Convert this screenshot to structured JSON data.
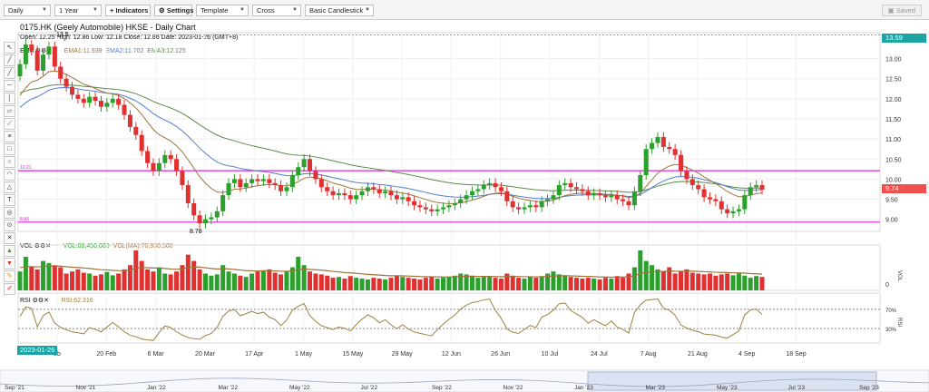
{
  "toolbar": {
    "interval": "Daily",
    "range": "1 Year",
    "indicators": "+ Indicators",
    "settings": "Settings",
    "template": "Template",
    "cursor": "Cross",
    "chart_type": "Basic Candlestick",
    "saved": "Saved"
  },
  "header": {
    "title": "0175.HK (Geely Automobile) HKSE - Daily Chart",
    "ohlc": "Open: 12.25  High: 12.86  Low: 12.18  Close: 12.86  Date: 2023-01-26 (GMT+8)",
    "ema_label": "EMA",
    "ema1": "EMA1:11.939",
    "ema2": "EMA2:11.702",
    "ema3": "EMA3:12.125",
    "vol_label": "VOL",
    "vol": "VOL:88,456,000",
    "vol_ma": "VOL(MA):70,930,500",
    "rsi_label": "RSI",
    "rsi": "RSI:62.316"
  },
  "annotations": {
    "high_label": "13.5",
    "low_label": "8.78",
    "upper_line": "10.21",
    "lower_line": "8.93",
    "last_price": "9.74",
    "top_price": "13.59",
    "cursor_date": "2023-01-26"
  },
  "colors": {
    "up": "#2ca02c",
    "down": "#e03030",
    "ema1": "#a0723a",
    "ema2": "#4f7fd0",
    "ema3": "#5a8a4a",
    "hline": "#e020e0",
    "rsi": "#a08040",
    "vol_ma": "#a0723a"
  },
  "chart_data": {
    "type": "candlestick",
    "title": "0175.HK (Geely Automobile) HKSE - Daily Chart",
    "xlim": [
      "2023-01-26",
      "2023-09-30"
    ],
    "ylim": [
      8.7,
      13.6
    ],
    "price_ticks": [
      "13.00",
      "12.50",
      "12.00",
      "11.50",
      "11.00",
      "10.50",
      "10.00",
      "9.50",
      "9.00"
    ],
    "x_ticks": [
      "eb",
      "20 Feb",
      "6 Mar",
      "20 Mar",
      "17 Apr",
      "1 May",
      "15 May",
      "29 May",
      "12 Jun",
      "26 Jun",
      "10 Jul",
      "24 Jul",
      "7 Aug",
      "21 Aug",
      "4 Sep",
      "18 Sep"
    ],
    "horizontal_lines": [
      10.21,
      8.93
    ],
    "close": [
      12.86,
      13.35,
      13.2,
      12.7,
      13.1,
      13.3,
      12.8,
      12.5,
      12.3,
      12.1,
      12.0,
      11.9,
      12.05,
      11.95,
      11.8,
      11.9,
      12.0,
      11.85,
      11.6,
      11.3,
      11.1,
      10.7,
      10.4,
      10.2,
      10.4,
      10.6,
      10.5,
      10.2,
      9.85,
      9.4,
      9.1,
      8.9,
      9.0,
      9.05,
      9.2,
      9.6,
      9.9,
      10.0,
      9.8,
      9.9,
      10.0,
      9.95,
      10.0,
      9.9,
      9.85,
      9.7,
      9.8,
      10.1,
      10.3,
      10.5,
      10.2,
      10.0,
      9.8,
      9.7,
      9.6,
      9.65,
      9.6,
      9.5,
      9.6,
      9.7,
      9.8,
      9.75,
      9.65,
      9.7,
      9.6,
      9.5,
      9.55,
      9.45,
      9.35,
      9.3,
      9.25,
      9.2,
      9.25,
      9.3,
      9.35,
      9.4,
      9.5,
      9.6,
      9.7,
      9.75,
      9.85,
      9.9,
      9.8,
      9.7,
      9.45,
      9.3,
      9.25,
      9.3,
      9.35,
      9.3,
      9.45,
      9.5,
      9.6,
      9.85,
      9.9,
      9.8,
      9.75,
      9.7,
      9.6,
      9.65,
      9.6,
      9.55,
      9.6,
      9.5,
      9.45,
      9.35,
      9.7,
      10.1,
      10.75,
      10.9,
      11.05,
      10.8,
      10.75,
      10.6,
      10.2,
      10.0,
      9.85,
      9.75,
      9.55,
      9.5,
      9.45,
      9.25,
      9.15,
      9.2,
      9.25,
      9.6,
      9.8,
      9.85,
      9.74
    ],
    "volume": [
      45,
      80,
      55,
      50,
      70,
      65,
      60,
      55,
      40,
      45,
      50,
      42,
      40,
      35,
      38,
      44,
      36,
      40,
      50,
      60,
      95,
      70,
      50,
      45,
      55,
      40,
      38,
      45,
      60,
      85,
      70,
      50,
      40,
      35,
      38,
      60,
      45,
      40,
      35,
      32,
      40,
      45,
      48,
      50,
      42,
      38,
      45,
      55,
      80,
      60,
      45,
      40,
      38,
      35,
      30,
      32,
      28,
      34,
      30,
      28,
      26,
      30,
      28,
      26,
      30,
      35,
      32,
      30,
      28,
      26,
      30,
      32,
      28,
      30,
      32,
      35,
      40,
      38,
      35,
      30,
      32,
      34,
      30,
      28,
      40,
      35,
      30,
      28,
      32,
      30,
      34,
      40,
      45,
      38,
      36,
      32,
      30,
      28,
      30,
      28,
      26,
      30,
      28,
      34,
      30,
      40,
      55,
      95,
      70,
      60,
      50,
      45,
      55,
      40,
      45,
      50,
      42,
      40,
      38,
      40,
      35,
      38,
      40,
      36,
      40,
      35,
      30,
      34,
      32
    ],
    "rsi_levels": [
      70,
      30
    ],
    "rsi_last": 62.316,
    "navigator_labels": [
      "Sep '21",
      "Nov '21",
      "Jan '22",
      "Mar '22",
      "May '22",
      "Jul '22",
      "Sep '22",
      "Nov '22",
      "Jan '23",
      "Mar '23",
      "May '23",
      "Jul '23",
      "Sep '23"
    ]
  }
}
